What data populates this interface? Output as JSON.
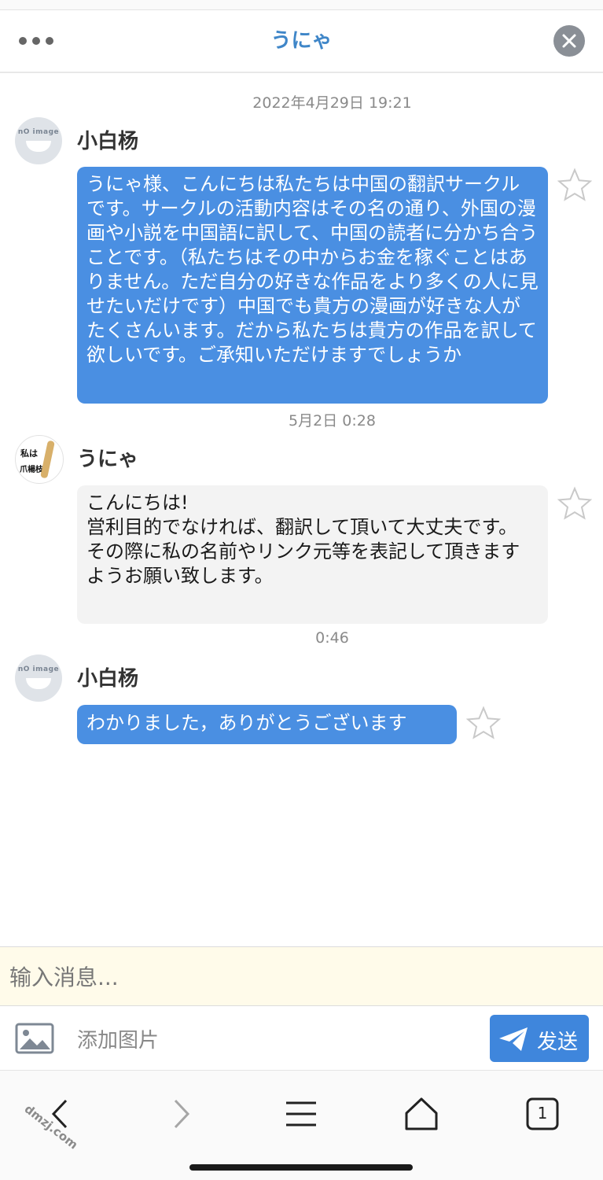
{
  "header": {
    "title": "うにゃ",
    "more_icon": "more-dots-icon",
    "close_icon": "close-icon"
  },
  "messages": [
    {
      "timestamp": "2022年4月29日 19:21",
      "sender": "小白杨",
      "avatar": "no-image",
      "avatar_text": "nO image",
      "bubble_color": "#4a8fe2",
      "text": "うにゃ様、こんにちは私たちは中国の翻訳サークルです。サークルの活動内容はその名の通り、外国の漫画や小説を中国語に訳して、中国の読者に分かち合うことです。（私たちはその中からお金を稼ぐことはありません。ただ自分の好きな作品をより多くの人に見せたいだけです）中国でも貴方の漫画が好きな人がたくさんいます。だから私たちは貴方の作品を訳して欲しいです。ご承知いただけますでしょうか"
    },
    {
      "timestamp": "5月2日 0:28",
      "sender": "うにゃ",
      "avatar": "profile-picture",
      "avatar_text": [
        "私は",
        "爪楊枝"
      ],
      "bubble_color": "#f3f3f3",
      "lines": [
        "こんにちは!",
        "営利目的でなければ、翻訳して頂いて大丈夫です。",
        "その際に私の名前やリンク元等を表記して頂きますようお願い致します。"
      ]
    },
    {
      "timestamp": "0:46",
      "sender": "小白杨",
      "avatar": "no-image",
      "avatar_text": "nO image",
      "bubble_color": "#4a8fe2",
      "text": "わかりました，ありがとうございます"
    }
  ],
  "composer": {
    "placeholder": "输入消息...",
    "value": "",
    "add_image_label": "添加图片",
    "send_label": "发送"
  },
  "browser_nav": {
    "tab_count": "1",
    "icons": [
      "back-icon",
      "forward-icon",
      "menu-icon",
      "home-icon",
      "tabs-icon"
    ]
  },
  "watermark": "dmzj.com",
  "colors": {
    "accent": "#3f86c8",
    "outgoing_bubble": "#4a8fe2",
    "incoming_bubble": "#f3f3f3",
    "send_button": "#3f86dc",
    "input_background": "#fffbea"
  }
}
